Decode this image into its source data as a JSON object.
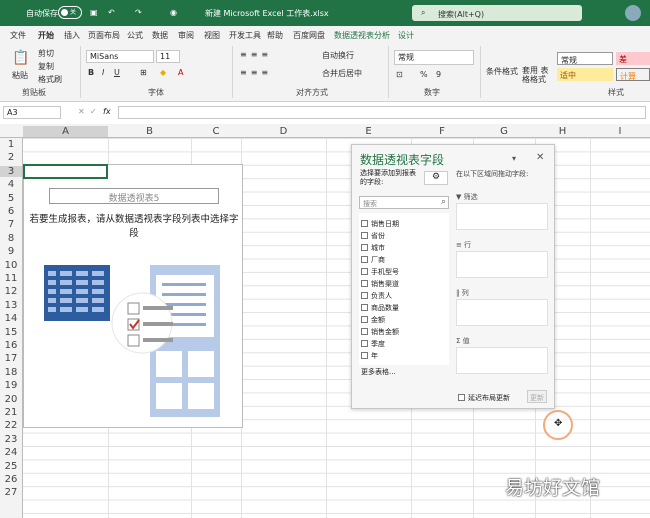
{
  "titlebar": {
    "autosave_label": "自动保存",
    "toggle_state": "关",
    "filename": "新建 Microsoft Excel 工作表.xlsx",
    "search_placeholder": "搜索(Alt+Q)"
  },
  "tabs": [
    "文件",
    "开始",
    "插入",
    "页面布局",
    "公式",
    "数据",
    "审阅",
    "视图",
    "开发工具",
    "帮助",
    "百度网盘",
    "数据透视表分析",
    "设计"
  ],
  "ribbon": {
    "paste": "粘贴",
    "cut": "剪切",
    "copy": "复制",
    "format_painter": "格式刷",
    "font_name": "MiSans",
    "font_size": "11",
    "wrap_text": "自动换行",
    "merge_center": "合并后居中",
    "number_format": "常规",
    "conditional_format": "条件格式",
    "table_format": "套用 表格格式",
    "style_normal": "常规",
    "style_bad": "差",
    "style_neutral": "适中",
    "style_calc": "计算",
    "groups": {
      "clipboard": "剪贴板",
      "font": "字体",
      "alignment": "对齐方式",
      "number": "数字",
      "styles": "样式"
    }
  },
  "formula": {
    "cell_ref": "A3",
    "fx": "fx"
  },
  "columns": [
    "A",
    "B",
    "C",
    "D",
    "E",
    "F",
    "G",
    "H",
    "I"
  ],
  "rows": [
    "1",
    "2",
    "3",
    "4",
    "5",
    "6",
    "7",
    "8",
    "9",
    "10",
    "11",
    "12",
    "13",
    "14",
    "15",
    "16",
    "17",
    "18",
    "19",
    "20",
    "21",
    "22",
    "23",
    "24",
    "25",
    "26",
    "27"
  ],
  "pivot": {
    "title": "数据透视表5",
    "instruction": "若要生成报表，请从数据透视表字段列表中选择字段"
  },
  "pane": {
    "title": "数据透视表字段",
    "choose_label": "选择要添加到报表的字段:",
    "search_placeholder": "搜索",
    "fields": [
      "销售日期",
      "省份",
      "城市",
      "厂商",
      "手机型号",
      "销售渠道",
      "负责人",
      "商品数量",
      "金额",
      "销售金额",
      "季度",
      "年"
    ],
    "more_tables": "更多表格...",
    "drag_label": "在以下区域间拖动字段:",
    "zones": [
      "筛选",
      "行",
      "列",
      "值"
    ],
    "defer_label": "延迟布局更新",
    "update_button": "更新"
  },
  "watermark": "易坊好文馆"
}
